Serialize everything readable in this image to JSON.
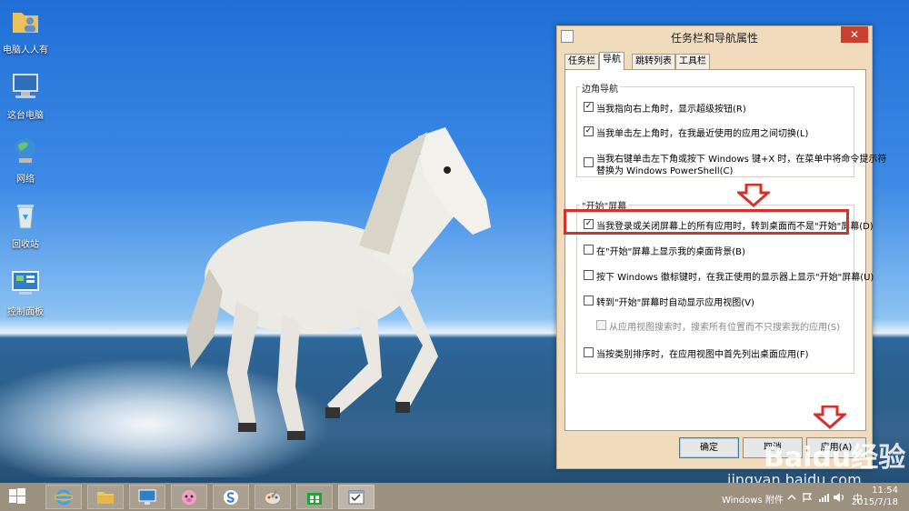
{
  "desktop": {
    "icons": [
      {
        "label": "电脑人人有",
        "icon": "folder-user-icon"
      },
      {
        "label": "这台电脑",
        "icon": "computer-icon"
      },
      {
        "label": "网络",
        "icon": "network-icon"
      },
      {
        "label": "回收站",
        "icon": "recycle-bin-icon"
      },
      {
        "label": "控制面板",
        "icon": "control-panel-icon"
      }
    ]
  },
  "dialog": {
    "title": "任务栏和导航属性",
    "close_glyph": "✕",
    "tabs": [
      {
        "label": "任务栏",
        "active": false
      },
      {
        "label": "导航",
        "active": true
      },
      {
        "label": "跳转列表",
        "active": false
      },
      {
        "label": "工具栏",
        "active": false
      }
    ],
    "corner_group": {
      "label": "边角导航",
      "options": [
        {
          "text": "当我指向右上角时，显示超级按钮(R)",
          "checked": true
        },
        {
          "text": "当我单击左上角时，在我最近使用的应用之间切换(L)",
          "checked": true
        },
        {
          "text": "当我右键单击左下角或按下 Windows 键+X 时，在菜单中将命令提示符",
          "text2": "替换为 Windows PowerShell(C)",
          "checked": false
        }
      ]
    },
    "start_group": {
      "label": "\"开始\"屏幕",
      "options": [
        {
          "text": "当我登录或关闭屏幕上的所有应用时，转到桌面而不是\"开始\"屏幕(D)",
          "checked": true,
          "disabled": false
        },
        {
          "text": "在\"开始\"屏幕上显示我的桌面背景(B)",
          "checked": false,
          "disabled": false
        },
        {
          "text": "按下 Windows 徽标键时，在我正使用的显示器上显示\"开始\"屏幕(U)",
          "checked": false,
          "disabled": false
        },
        {
          "text": "转到\"开始\"屏幕时自动显示应用视图(V)",
          "checked": false,
          "disabled": false
        },
        {
          "text": "从应用视图搜索时，搜索所有位置而不只搜索我的应用(S)",
          "checked": false,
          "disabled": true
        },
        {
          "text": "当按类别排序时，在应用视图中首先列出桌面应用(F)",
          "checked": false,
          "disabled": false
        }
      ]
    },
    "buttons": {
      "ok": "确定",
      "cancel": "取消",
      "apply": "应用(A)"
    },
    "check_glyph": "✓"
  },
  "watermark": {
    "brand": "Baidu经验",
    "url": "jingyan.baidu.com"
  },
  "taskbar": {
    "apps": [
      {
        "name": "internet-explorer",
        "icon": "ie-icon"
      },
      {
        "name": "file-explorer",
        "icon": "folder-icon"
      },
      {
        "name": "remote-desktop",
        "icon": "remote-desktop-icon"
      },
      {
        "name": "app-pig",
        "icon": "pig-icon"
      },
      {
        "name": "sogou",
        "icon": "sogou-icon"
      },
      {
        "name": "paint",
        "icon": "paint-icon"
      },
      {
        "name": "store",
        "icon": "store-icon"
      },
      {
        "name": "properties-window",
        "icon": "window-icon"
      }
    ],
    "tray_label": "Windows 附件",
    "ime": "中",
    "time": "11:54",
    "date": "2015/7/18"
  },
  "colors": {
    "dialog_bg": "#f0dcbd",
    "close_btn": "#c8402f",
    "highlight": "#d6302a",
    "taskbar": "#9c907f"
  }
}
